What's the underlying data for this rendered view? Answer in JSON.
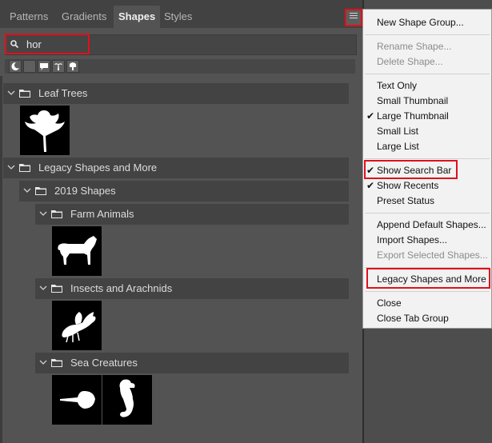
{
  "tabs": [
    {
      "label": "Patterns"
    },
    {
      "label": "Gradients"
    },
    {
      "label": "Shapes"
    },
    {
      "label": "Styles"
    }
  ],
  "search": {
    "value": "hor",
    "placeholder": ""
  },
  "tree": {
    "leaf_trees": "Leaf Trees",
    "legacy": "Legacy Shapes and More",
    "shapes_2019": "2019 Shapes",
    "farm_animals": "Farm Animals",
    "insects": "Insects and Arachnids",
    "sea_creatures": "Sea Creatures"
  },
  "menu": {
    "new_group": "New Shape Group...",
    "rename": "Rename Shape...",
    "delete": "Delete Shape...",
    "text_only": "Text Only",
    "small_thumb": "Small Thumbnail",
    "large_thumb": "Large Thumbnail",
    "small_list": "Small List",
    "large_list": "Large List",
    "show_search": "Show Search Bar",
    "show_recents": "Show Recents",
    "preset_status": "Preset Status",
    "append_default": "Append Default Shapes...",
    "import": "Import Shapes...",
    "export": "Export Selected Shapes...",
    "legacy": "Legacy Shapes and More",
    "close": "Close",
    "close_tab_group": "Close Tab Group",
    "check_mark": "✔"
  },
  "colors": {
    "accent_highlight": "#e0101c",
    "panel_bg": "#535353",
    "menu_bg": "#f2f2f2"
  }
}
